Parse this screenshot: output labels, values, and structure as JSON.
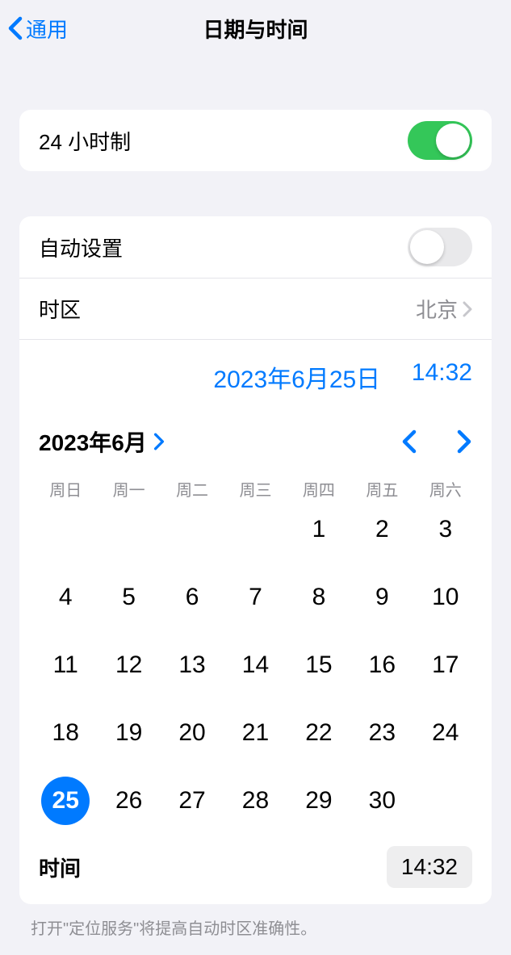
{
  "nav": {
    "back": "通用",
    "title": "日期与时间"
  },
  "settings": {
    "clock24": {
      "label": "24 小时制",
      "on": true
    },
    "autoSet": {
      "label": "自动设置",
      "on": false
    },
    "timezone": {
      "label": "时区",
      "value": "北京"
    }
  },
  "datetime": {
    "date": "2023年6月25日",
    "time": "14:32"
  },
  "calendar": {
    "monthLabel": "2023年6月",
    "weekdays": [
      "周日",
      "周一",
      "周二",
      "周三",
      "周四",
      "周五",
      "周六"
    ],
    "startOffset": 4,
    "daysInMonth": 30,
    "selected": 25
  },
  "timeRow": {
    "label": "时间",
    "value": "14:32"
  },
  "footer": "打开\"定位服务\"将提高自动时区准确性。"
}
